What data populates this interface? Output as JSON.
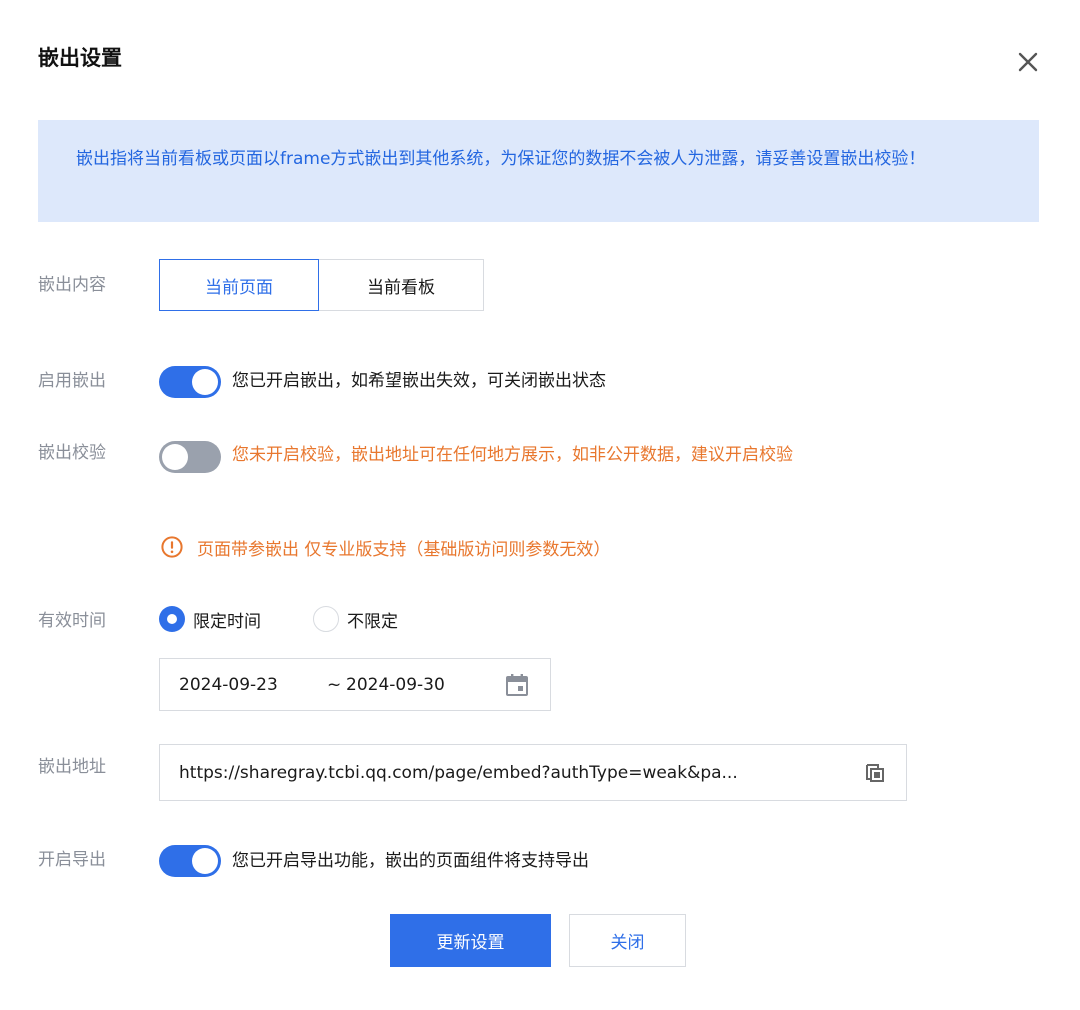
{
  "dialog": {
    "title": "嵌出设置",
    "close_icon": "close-icon"
  },
  "notice": {
    "text": "嵌出指将当前看板或页面以frame方式嵌出到其他系统，为保证您的数据不会被人为泄露，请妥善设置嵌出校验！"
  },
  "embed_content": {
    "label": "嵌出内容",
    "options": [
      "当前页面",
      "当前看板"
    ],
    "selected": "当前页面"
  },
  "enable_embed": {
    "label": "启用嵌出",
    "on": true,
    "description": "您已开启嵌出，如希望嵌出失效，可关闭嵌出状态"
  },
  "embed_verify": {
    "label": "嵌出校验",
    "on": false,
    "description": "您未开启校验，嵌出地址可在任何地方展示，如非公开数据，建议开启校验"
  },
  "param_warning": {
    "icon": "warning-circle-icon",
    "text": "页面带参嵌出 仅专业版支持（基础版访问则参数无效）"
  },
  "valid_time": {
    "label": "有效时间",
    "options": [
      "限定时间",
      "不限定"
    ],
    "selected": "限定时间",
    "start_date": "2024-09-23",
    "separator": "~",
    "end_date": "2024-09-30",
    "calendar_icon": "calendar-icon"
  },
  "embed_url": {
    "label": "嵌出地址",
    "value": "https://sharegray.tcbi.qq.com/page/embed?authType=weak&pa...",
    "copy_icon": "copy-icon"
  },
  "enable_export": {
    "label": "开启导出",
    "on": true,
    "description": "您已开启导出功能，嵌出的页面组件将支持导出"
  },
  "footer": {
    "update_label": "更新设置",
    "close_label": "关闭"
  },
  "colors": {
    "accent": "#2f6fe8",
    "warning": "#e8772e",
    "notice_bg": "#dde8fb",
    "label_gray": "#8a8f99"
  }
}
